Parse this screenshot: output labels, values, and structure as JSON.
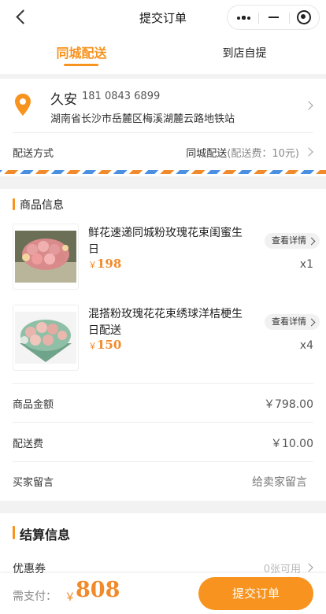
{
  "header": {
    "title": "提交订单"
  },
  "tabs": [
    {
      "label": "同城配送",
      "active": true
    },
    {
      "label": "到店自提",
      "active": false
    }
  ],
  "address": {
    "name": "久安",
    "phone": "181 0843 6899",
    "detail": "湖南省长沙市岳麓区梅溪湖麓云路地铁站"
  },
  "shipping": {
    "label": "配送方式",
    "method": "同城配送",
    "fee_text": "(配送费：10元)"
  },
  "goods": {
    "section_title": "商品信息",
    "items": [
      {
        "title": "鲜花速递同城粉玫瑰花束闺蜜生日",
        "yen": "￥",
        "price": "198",
        "detail_label": "查看详情",
        "qty": "x1"
      },
      {
        "title": "混搭粉玫瑰花花束绣球洋桔梗生日配送",
        "yen": "￥",
        "price": "150",
        "detail_label": "查看详情",
        "qty": "x4"
      }
    ],
    "summary": [
      {
        "label": "商品金额",
        "value": "￥798.00"
      },
      {
        "label": "配送费",
        "value": "￥10.00"
      },
      {
        "label": "买家留言",
        "value": "给卖家留言"
      }
    ]
  },
  "settlement": {
    "section_title": "结算信息",
    "coupon_label": "优惠券",
    "coupon_value": "0张可用"
  },
  "footer": {
    "pay_label": "需支付：",
    "yen": "￥",
    "amount": "808",
    "submit_label": "提交订单"
  },
  "colors": {
    "accent": "#f7931e",
    "price": "#f18a2a",
    "stripe_blue": "#4a90e2"
  }
}
